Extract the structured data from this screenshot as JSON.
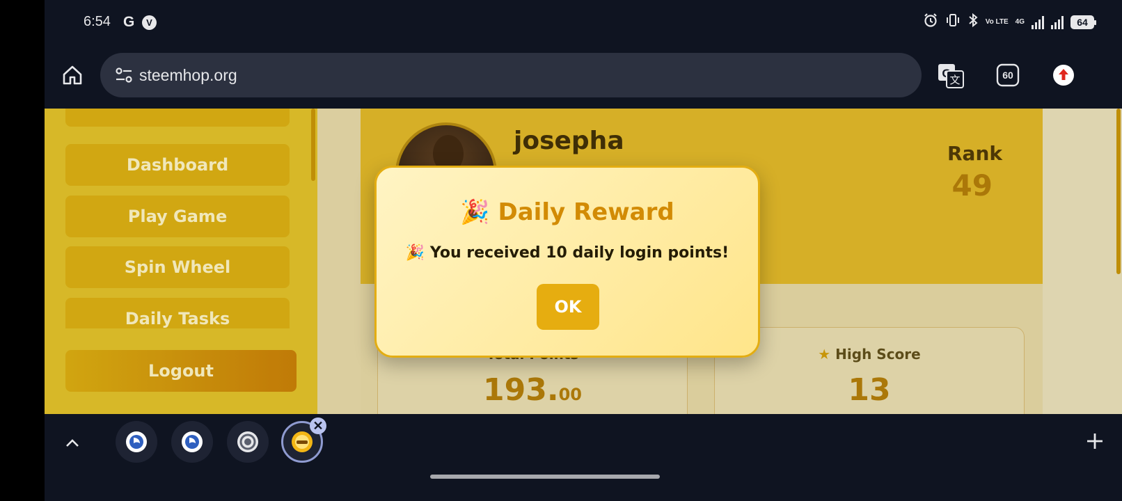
{
  "status_bar": {
    "time": "6:54",
    "google_icon": "G",
    "vpn_icon": "V",
    "lte_label": "Vo LTE",
    "network_label": "4G",
    "battery": "64"
  },
  "browser": {
    "url": "steemhop.org",
    "tab_count": "60"
  },
  "sidebar": {
    "items": [
      {
        "label": "Dashboard"
      },
      {
        "label": "Play Game"
      },
      {
        "label": "Spin Wheel"
      },
      {
        "label": "Daily Tasks"
      }
    ],
    "logout_label": "Logout"
  },
  "profile": {
    "username": "josepha",
    "rank_label": "Rank",
    "rank_value": "49"
  },
  "stats": {
    "total_points_label": "Total Points",
    "total_points_main": "193.",
    "total_points_decimal": "00",
    "high_score_label": "High Score",
    "high_score_value": "13"
  },
  "modal": {
    "title_emoji": "🎉",
    "title": "Daily Reward",
    "message_emoji": "🎉",
    "message": "You received 10 daily login points!",
    "ok_label": "OK"
  },
  "colors": {
    "accent": "#e6ad10",
    "brand_gold": "#dfb629",
    "browser_bg": "#0f1421"
  }
}
